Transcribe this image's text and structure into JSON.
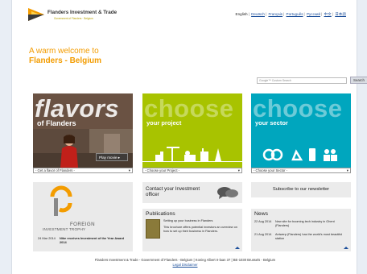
{
  "brand": {
    "name": "Flanders Investment & Trade",
    "tagline": "Government of Flanders · Belgium"
  },
  "languages": {
    "current": "English",
    "links": [
      "Deutsch",
      "Français",
      "Português",
      "Русский",
      "中文",
      "日本語"
    ]
  },
  "welcome": {
    "line1": "A warm welcome to",
    "line2": "Flanders - Belgium"
  },
  "search": {
    "placeholder": "Google™ Custom Search",
    "button": "Search"
  },
  "tiles": {
    "flavors": {
      "big": "flavors",
      "sub": "of Flanders",
      "play": "Play movie ▸",
      "select": "- Get a flavor of Flanders -"
    },
    "project": {
      "big": "choose",
      "sub": "your project",
      "select": "- Choose your Project -"
    },
    "sector": {
      "big": "choose",
      "sub": "your sector",
      "select": "- Choose your Sector -"
    }
  },
  "trophy": {
    "line1": "FOREIGN",
    "line2": "INVESTMENT TROPHY",
    "date": "24 Mar 2014",
    "text": "Nike receives Investment of the Year Award 2014"
  },
  "contact": {
    "text": "Contact your Investment officer"
  },
  "publications": {
    "heading": "Publications",
    "title": "Setting up your business in Flanders",
    "desc": "This brochure offers potential investors an overview on how to set up their business in Flanders."
  },
  "newsletter": {
    "text": "Subscribe to our newsletter"
  },
  "news": {
    "heading": "News",
    "items": [
      {
        "date": "22 Aug 2014",
        "text": "New site for booming tech industry in Ghent (Flanders)"
      },
      {
        "date": "21 Aug 2014",
        "text": "Antwerp (Flanders) has the world's most beautiful station"
      }
    ]
  },
  "footer": {
    "line": "Flanders Investment & Trade - Government of Flanders - Belgium | Koning Albert II-laan 37 | BE-1030 Brussels - Belgium",
    "disclaimer": "Legal Disclaimer"
  },
  "colors": {
    "orange": "#f39c00",
    "brown": "#6a5243",
    "lime": "#a8c300",
    "cyan": "#00a6be"
  }
}
